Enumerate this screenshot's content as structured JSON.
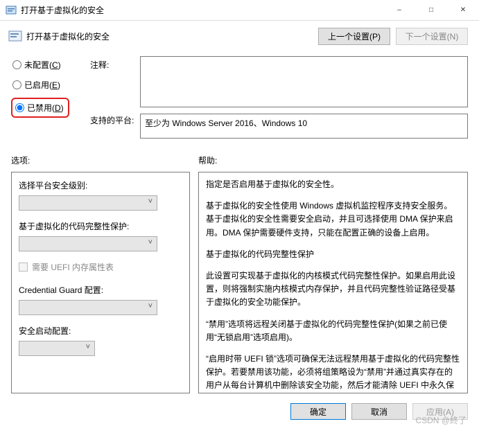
{
  "window": {
    "title": "打开基于虚拟化的安全"
  },
  "header": {
    "title": "打开基于虚拟化的安全",
    "prev": "上一个设置(P)",
    "next": "下一个设置(N)"
  },
  "radios": {
    "not_configured": "未配置(C)",
    "enabled": "已启用(E)",
    "disabled": "已禁用(D)",
    "selected": "disabled"
  },
  "labels": {
    "comment": "注释:",
    "platform": "支持的平台:",
    "options": "选项:",
    "help": "帮助:"
  },
  "fields": {
    "comment_value": "",
    "platform_value": "至少为 Windows Server 2016、Windows 10"
  },
  "options": {
    "platform_security_level": "选择平台安全级别:",
    "code_integrity": "基于虚拟化的代码完整性保护:",
    "uefi_table": "需要 UEFI 内存属性表",
    "credential_guard": "Credential Guard 配置:",
    "secure_launch": "安全启动配置:"
  },
  "help": {
    "p1": "指定是否启用基于虚拟化的安全性。",
    "p2": "基于虚拟化的安全性使用 Windows 虚拟机监控程序支持安全服务。基于虚拟化的安全性需要安全启动，并且可选择使用 DMA 保护来启用。DMA 保护需要硬件支持，只能在配置正确的设备上启用。",
    "p3": "基于虚拟化的代码完整性保护",
    "p4": "此设置可实现基于虚拟化的内核模式代码完整性保护。如果启用此设置，则将强制实施内核模式内存保护，并且代码完整性验证路径受基于虚拟化的安全功能保护。",
    "p5": "“禁用”选项将远程关闭基于虚拟化的代码完整性保护(如果之前已使用“无锁启用”选项启用)。",
    "p6": "“启用时带 UEFI 锁”选项可确保无法远程禁用基于虚拟化的代码完整性保护。若要禁用该功能，必须将组策略设为“禁用”并通过真实存在的用户从每台计算机中删除该安全功能，然后才能清除 UEFI 中永久保留的配置。"
  },
  "buttons": {
    "ok": "确定",
    "cancel": "取消",
    "apply": "应用(A)"
  },
  "watermark": "CSDN @終了"
}
